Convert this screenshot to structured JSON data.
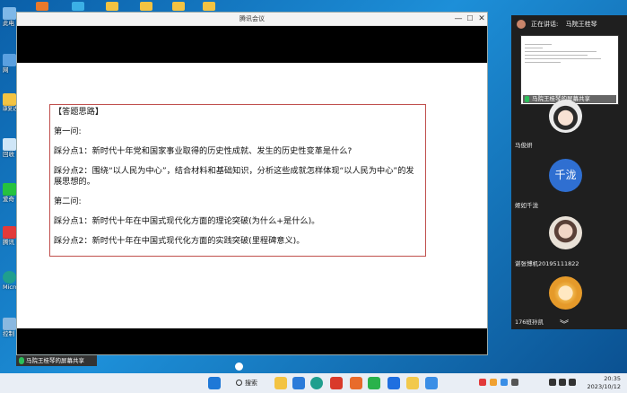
{
  "desktop": {
    "icons": [
      {
        "label": "此电"
      },
      {
        "label": "网"
      },
      {
        "label": "康复达 37班午"
      },
      {
        "label": "回收"
      },
      {
        "label": "爱奇"
      },
      {
        "label": "腾讯"
      },
      {
        "label": "Micro Ed"
      },
      {
        "label": "控制"
      }
    ]
  },
  "meeting_window": {
    "title": "腾讯会议",
    "minimize": "—",
    "maximize": "☐",
    "close": "✕"
  },
  "document": {
    "heading": "【答题思路】",
    "q1_title": "第一问:",
    "q1_point1": "踩分点1：新时代十年党和国家事业取得的历史性成就、发生的历史性变革是什么?",
    "q1_point2": "踩分点2：围绕“以人民为中心”，结合材料和基础知识，分析这些成就怎样体现“以人民为中心”的发展思想的。",
    "q2_title": "第二问:",
    "q2_point1": "踩分点1：新时代十年在中国式现代化方面的理论突破(为什么+是什么)。",
    "q2_point2": "踩分点2：新时代十年在中国式现代化方面的实践突破(里程碑意义)。"
  },
  "share_bar": {
    "label": "马院王桂琴的屏幕共享"
  },
  "side_panel": {
    "speaking_label": "正在讲话:",
    "speaker_name": "马院王桂琴",
    "screen_share_label": "马院王桂琴的屏幕共享",
    "participants": [
      {
        "name": "马俊妍"
      },
      {
        "name": "姬如千泷",
        "initials": "千泷"
      },
      {
        "name": "谌张博机20195111822"
      },
      {
        "name": "176班孙凯"
      }
    ]
  },
  "taskbar": {
    "search_label": "搜索",
    "time": "20:35",
    "date": "2023/10/12"
  },
  "colors": {
    "desktop_bg": "#1d8fd8",
    "box_border": "#c0504d",
    "mic_green": "#2bbf5a",
    "avatar_blue": "#2f6fd1"
  }
}
